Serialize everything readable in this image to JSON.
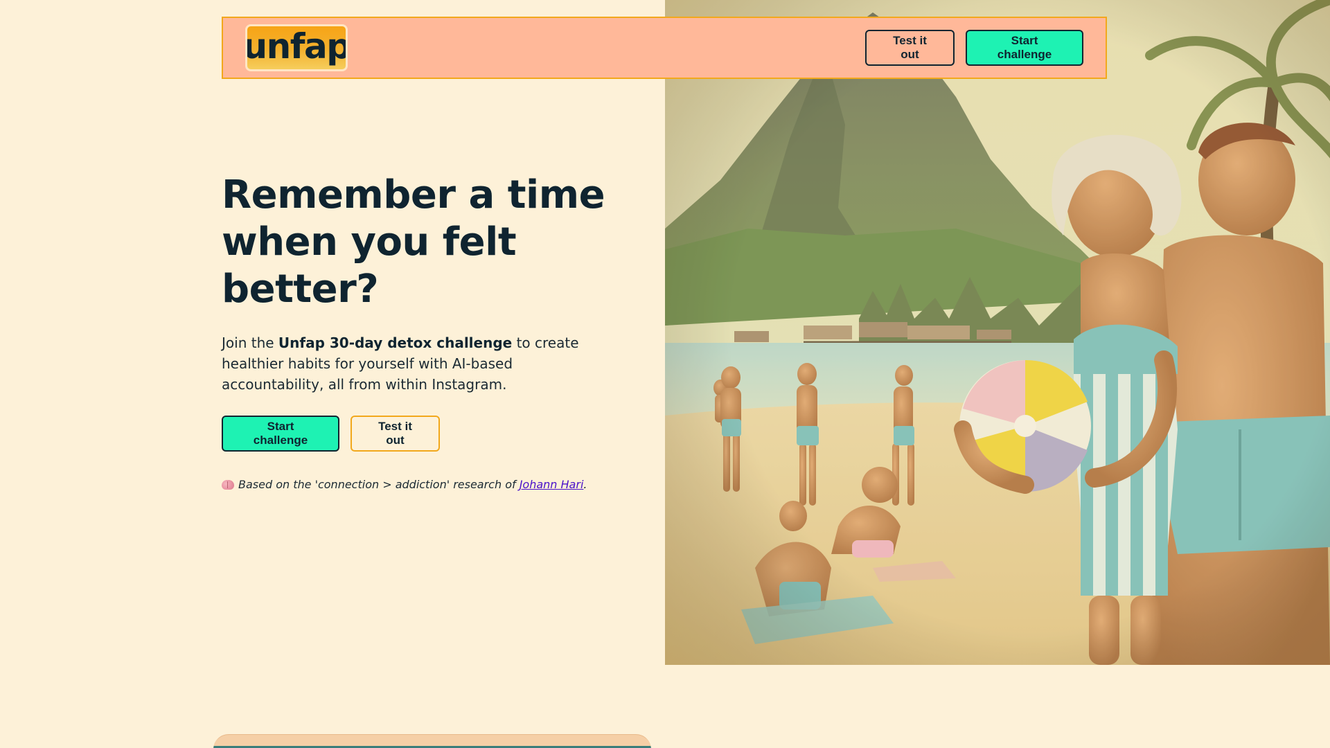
{
  "brand": {
    "logo_text": "unfap",
    "logo_gradient": [
      "#f7a416",
      "#f6cd5c"
    ]
  },
  "header": {
    "test_button_label": "Test it out",
    "start_button_label": "Start challenge",
    "background_color": "#ffb899",
    "border_color": "#f2a81c"
  },
  "hero": {
    "headline": "Remember a time when you felt better?",
    "subtext_before": "Join the ",
    "subtext_bold": "Unfap 30-day detox challenge",
    "subtext_after": " to create healthier habits for yourself with AI-based accountability, all from within Instagram.",
    "primary_button_label": "Start challenge",
    "secondary_button_label": "Test it out",
    "research_prefix": "Based on the 'connection > addiction' research of ",
    "research_link_text": "Johann Hari",
    "research_suffix": ".",
    "research_icon": "brain-icon",
    "image_description_icon": "vintage-beach-illustration"
  },
  "colors": {
    "page_background": "#fdf1d8",
    "primary_accent": "#1ef2b3",
    "text_dark": "#0f2430",
    "amber_border": "#f2a81c",
    "link": "#4a12c9"
  }
}
